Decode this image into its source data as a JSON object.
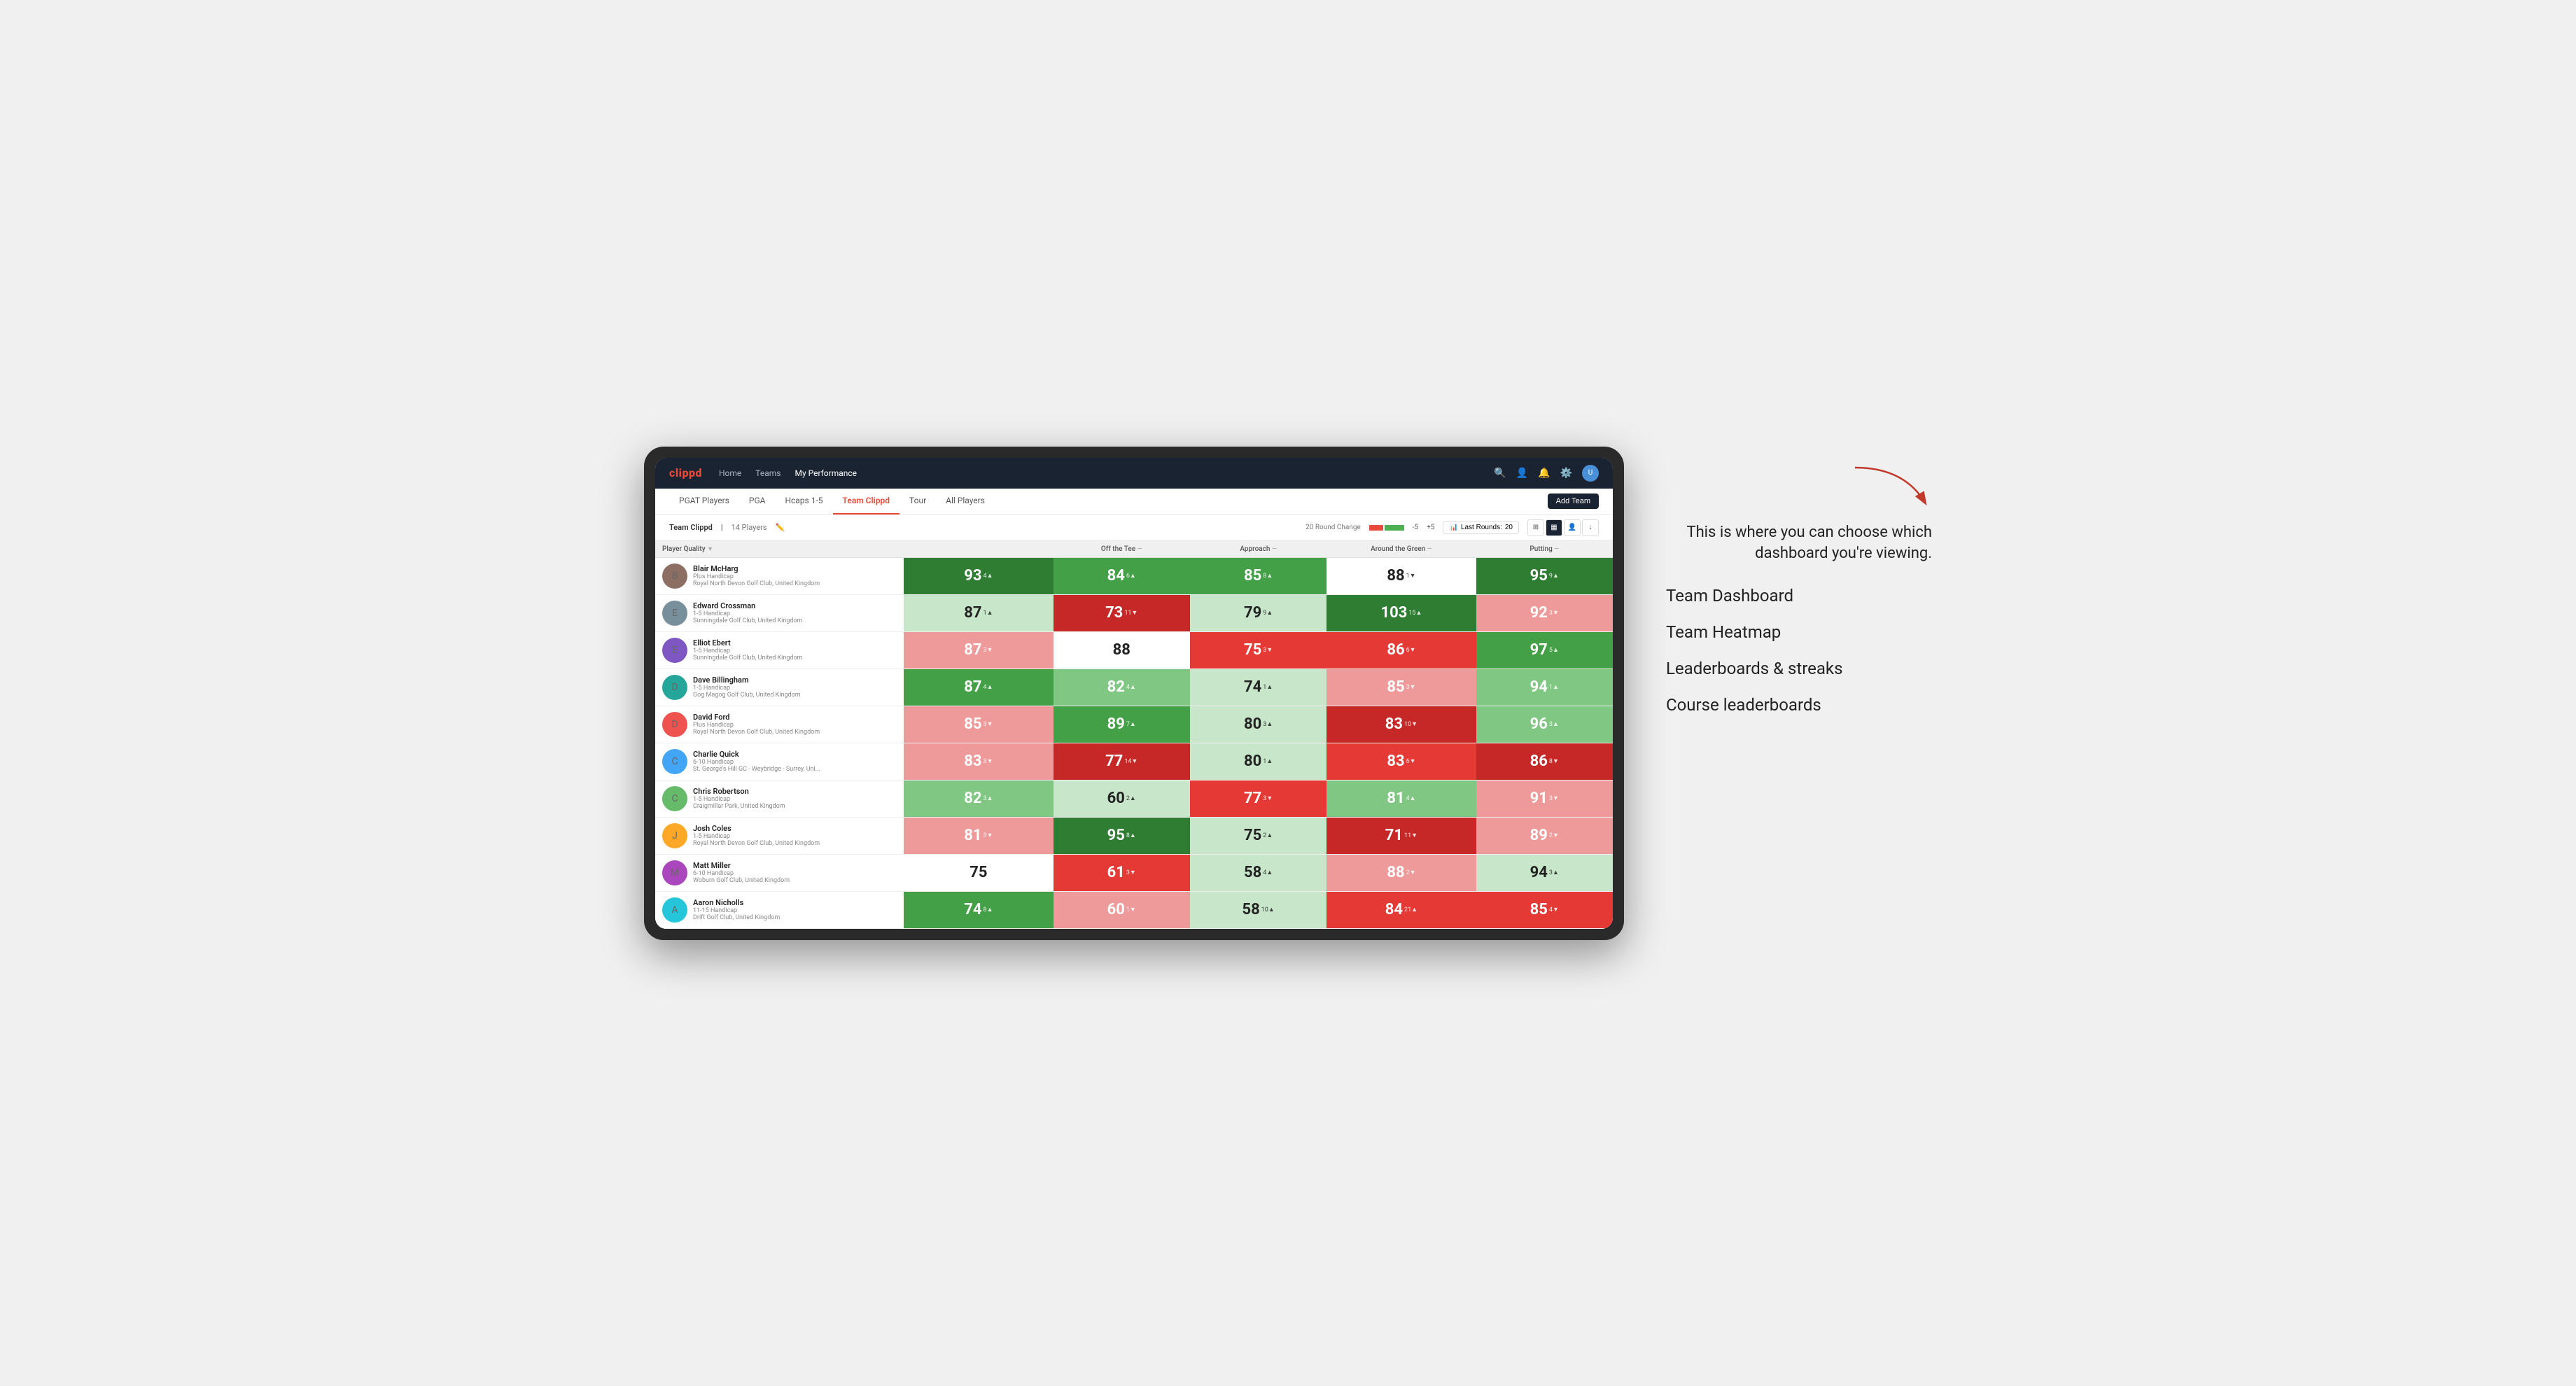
{
  "nav": {
    "logo": "clippd",
    "links": [
      "Home",
      "Teams",
      "My Performance"
    ],
    "icons": [
      "search",
      "person",
      "bell",
      "settings"
    ]
  },
  "sub_nav": {
    "tabs": [
      "PGAT Players",
      "PGA",
      "Hcaps 1-5",
      "Team Clippd",
      "Tour",
      "All Players"
    ],
    "active": "Team Clippd",
    "add_team_label": "Add Team"
  },
  "team_bar": {
    "title": "Team Clippd",
    "separator": "|",
    "count_label": "14 Players",
    "round_change_label": "20 Round Change",
    "neg_label": "-5",
    "pos_label": "+5",
    "last_rounds_label": "Last Rounds:",
    "last_rounds_value": "20"
  },
  "columns": {
    "player": "Player Quality",
    "tee": "Off the Tee",
    "approach": "Approach",
    "green": "Around the Green",
    "putting": "Putting"
  },
  "players": [
    {
      "name": "Blair McHarg",
      "handicap": "Plus Handicap",
      "club": "Royal North Devon Golf Club, United Kingdom",
      "quality": {
        "score": "93",
        "change": "4",
        "dir": "up",
        "bg": "green-dark"
      },
      "tee": {
        "score": "84",
        "change": "6",
        "dir": "up",
        "bg": "green-mid"
      },
      "approach": {
        "score": "85",
        "change": "8",
        "dir": "up",
        "bg": "green-mid"
      },
      "green": {
        "score": "88",
        "change": "1",
        "dir": "down",
        "bg": "white"
      },
      "putting": {
        "score": "95",
        "change": "9",
        "dir": "up",
        "bg": "green-dark"
      }
    },
    {
      "name": "Edward Crossman",
      "handicap": "1-5 Handicap",
      "club": "Sunningdale Golf Club, United Kingdom",
      "quality": {
        "score": "87",
        "change": "1",
        "dir": "up",
        "bg": "light-green"
      },
      "tee": {
        "score": "73",
        "change": "11",
        "dir": "down",
        "bg": "red-dark"
      },
      "approach": {
        "score": "79",
        "change": "9",
        "dir": "up",
        "bg": "light-green"
      },
      "green": {
        "score": "103",
        "change": "15",
        "dir": "up",
        "bg": "green-dark"
      },
      "putting": {
        "score": "92",
        "change": "3",
        "dir": "down",
        "bg": "red-light"
      }
    },
    {
      "name": "Elliot Ebert",
      "handicap": "1-5 Handicap",
      "club": "Sunningdale Golf Club, United Kingdom",
      "quality": {
        "score": "87",
        "change": "3",
        "dir": "down",
        "bg": "red-light"
      },
      "tee": {
        "score": "88",
        "change": "",
        "dir": "none",
        "bg": "white"
      },
      "approach": {
        "score": "75",
        "change": "3",
        "dir": "down",
        "bg": "red-mid"
      },
      "green": {
        "score": "86",
        "change": "6",
        "dir": "down",
        "bg": "red-mid"
      },
      "putting": {
        "score": "97",
        "change": "5",
        "dir": "up",
        "bg": "green-mid"
      }
    },
    {
      "name": "Dave Billingham",
      "handicap": "1-5 Handicap",
      "club": "Gog Magog Golf Club, United Kingdom",
      "quality": {
        "score": "87",
        "change": "4",
        "dir": "up",
        "bg": "green-mid"
      },
      "tee": {
        "score": "82",
        "change": "4",
        "dir": "up",
        "bg": "green-light"
      },
      "approach": {
        "score": "74",
        "change": "1",
        "dir": "up",
        "bg": "light-green"
      },
      "green": {
        "score": "85",
        "change": "3",
        "dir": "down",
        "bg": "red-light"
      },
      "putting": {
        "score": "94",
        "change": "1",
        "dir": "up",
        "bg": "green-light"
      }
    },
    {
      "name": "David Ford",
      "handicap": "Plus Handicap",
      "club": "Royal North Devon Golf Club, United Kingdom",
      "quality": {
        "score": "85",
        "change": "3",
        "dir": "down",
        "bg": "red-light"
      },
      "tee": {
        "score": "89",
        "change": "7",
        "dir": "up",
        "bg": "green-mid"
      },
      "approach": {
        "score": "80",
        "change": "3",
        "dir": "up",
        "bg": "light-green"
      },
      "green": {
        "score": "83",
        "change": "10",
        "dir": "down",
        "bg": "red-dark"
      },
      "putting": {
        "score": "96",
        "change": "3",
        "dir": "up",
        "bg": "green-light"
      }
    },
    {
      "name": "Charlie Quick",
      "handicap": "6-10 Handicap",
      "club": "St. George's Hill GC - Weybridge - Surrey, Uni...",
      "quality": {
        "score": "83",
        "change": "3",
        "dir": "down",
        "bg": "red-light"
      },
      "tee": {
        "score": "77",
        "change": "14",
        "dir": "down",
        "bg": "red-dark"
      },
      "approach": {
        "score": "80",
        "change": "1",
        "dir": "up",
        "bg": "light-green"
      },
      "green": {
        "score": "83",
        "change": "6",
        "dir": "down",
        "bg": "red-mid"
      },
      "putting": {
        "score": "86",
        "change": "8",
        "dir": "down",
        "bg": "red-dark"
      }
    },
    {
      "name": "Chris Robertson",
      "handicap": "1-5 Handicap",
      "club": "Craigmillar Park, United Kingdom",
      "quality": {
        "score": "82",
        "change": "3",
        "dir": "up",
        "bg": "green-light"
      },
      "tee": {
        "score": "60",
        "change": "2",
        "dir": "up",
        "bg": "light-green"
      },
      "approach": {
        "score": "77",
        "change": "3",
        "dir": "down",
        "bg": "red-mid"
      },
      "green": {
        "score": "81",
        "change": "4",
        "dir": "up",
        "bg": "green-light"
      },
      "putting": {
        "score": "91",
        "change": "3",
        "dir": "down",
        "bg": "red-light"
      }
    },
    {
      "name": "Josh Coles",
      "handicap": "1-5 Handicap",
      "club": "Royal North Devon Golf Club, United Kingdom",
      "quality": {
        "score": "81",
        "change": "3",
        "dir": "down",
        "bg": "red-light"
      },
      "tee": {
        "score": "95",
        "change": "8",
        "dir": "up",
        "bg": "green-dark"
      },
      "approach": {
        "score": "75",
        "change": "2",
        "dir": "up",
        "bg": "light-green"
      },
      "green": {
        "score": "71",
        "change": "11",
        "dir": "down",
        "bg": "red-dark"
      },
      "putting": {
        "score": "89",
        "change": "2",
        "dir": "down",
        "bg": "red-light"
      }
    },
    {
      "name": "Matt Miller",
      "handicap": "6-10 Handicap",
      "club": "Woburn Golf Club, United Kingdom",
      "quality": {
        "score": "75",
        "change": "",
        "dir": "none",
        "bg": "white"
      },
      "tee": {
        "score": "61",
        "change": "3",
        "dir": "down",
        "bg": "red-mid"
      },
      "approach": {
        "score": "58",
        "change": "4",
        "dir": "up",
        "bg": "light-green"
      },
      "green": {
        "score": "88",
        "change": "2",
        "dir": "down",
        "bg": "red-light"
      },
      "putting": {
        "score": "94",
        "change": "3",
        "dir": "up",
        "bg": "light-green"
      }
    },
    {
      "name": "Aaron Nicholls",
      "handicap": "11-15 Handicap",
      "club": "Drift Golf Club, United Kingdom",
      "quality": {
        "score": "74",
        "change": "8",
        "dir": "up",
        "bg": "green-mid"
      },
      "tee": {
        "score": "60",
        "change": "1",
        "dir": "down",
        "bg": "red-light"
      },
      "approach": {
        "score": "58",
        "change": "10",
        "dir": "up",
        "bg": "light-green"
      },
      "green": {
        "score": "84",
        "change": "21",
        "dir": "up",
        "bg": "red-mid"
      },
      "putting": {
        "score": "85",
        "change": "4",
        "dir": "down",
        "bg": "red-mid"
      }
    }
  ],
  "annotation": {
    "intro_text": "This is where you can choose which dashboard you're viewing.",
    "options": [
      "Team Dashboard",
      "Team Heatmap",
      "Leaderboards & streaks",
      "Course leaderboards"
    ]
  }
}
